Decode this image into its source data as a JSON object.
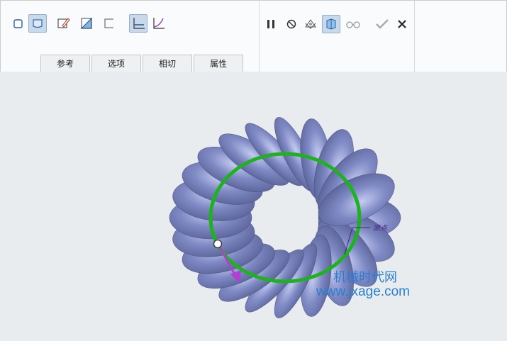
{
  "toolbar": {
    "tools_left": [
      {
        "name": "solid-icon"
      },
      {
        "name": "surface-icon",
        "active": true
      },
      {
        "name": "sketch-edit-icon"
      },
      {
        "name": "thicken-icon"
      },
      {
        "name": "open-profile-icon"
      },
      {
        "name": "linear-law-icon",
        "active": true
      },
      {
        "name": "graph-law-icon"
      }
    ],
    "tools_right": [
      {
        "name": "pause-icon"
      },
      {
        "name": "no-preview-icon"
      },
      {
        "name": "attached-preview-icon"
      },
      {
        "name": "detached-preview-icon",
        "active": true
      },
      {
        "name": "verify-preview-icon"
      },
      {
        "name": "ok-check-icon"
      },
      {
        "name": "cancel-x-icon"
      }
    ]
  },
  "tabs": [
    {
      "label": "参考"
    },
    {
      "label": "选项"
    },
    {
      "label": "相切"
    },
    {
      "label": "属性"
    }
  ],
  "viewport": {
    "trajectory_color": "#1fb21f",
    "surface_color": "#5f6b9e",
    "arrow_color": "#b23fd4",
    "origin_label": "原点",
    "watermark_line1": "机械时代网",
    "watermark_line2": "www.jxage.com"
  }
}
